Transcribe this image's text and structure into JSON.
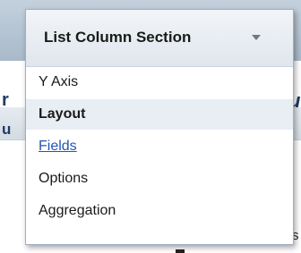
{
  "menu": {
    "title": "List Column Section",
    "items": [
      {
        "label": "Y Axis",
        "state": "normal"
      },
      {
        "label": "Layout",
        "state": "selected"
      },
      {
        "label": "Fields",
        "state": "hover-link"
      },
      {
        "label": "Options",
        "state": "normal"
      },
      {
        "label": "Aggregation",
        "state": "normal"
      }
    ]
  },
  "background": {
    "glyph_r": "r",
    "glyph_u_left": "u",
    "glyph_u_right": "u",
    "glyph_s": "s"
  },
  "colors": {
    "link": "#2255b8",
    "selected_row": "#e8eef3",
    "header_gradient_top": "#f2f5f8",
    "header_gradient_bottom": "#dfe6ed"
  },
  "icons": {
    "dropdown": "chevron-down-icon"
  }
}
